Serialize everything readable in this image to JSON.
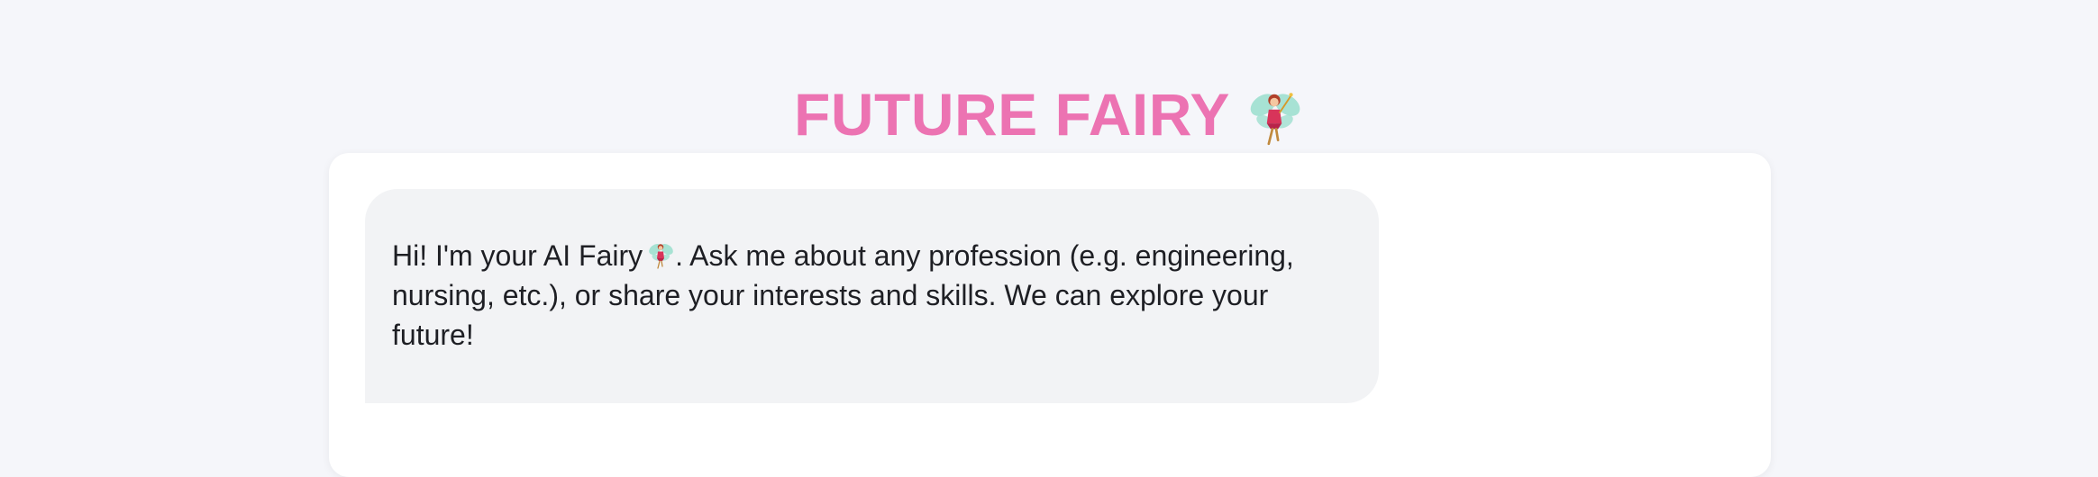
{
  "app": {
    "title": "FUTURE FAIRY",
    "title_icon": "fairy-icon",
    "title_color": "#ec73b2"
  },
  "chat": {
    "messages": [
      {
        "sender": "assistant",
        "text_before_icon": "Hi! I'm your AI Fairy",
        "icon": "fairy-icon",
        "text_after_icon": ". Ask me about any profession (e.g. engineering, nursing, etc.), or share your interests and skills. We can explore your future!"
      }
    ]
  },
  "colors": {
    "page_background": "#f5f6fa",
    "card_background": "#ffffff",
    "bubble_background": "#f2f3f5",
    "text": "#1e1f24"
  }
}
